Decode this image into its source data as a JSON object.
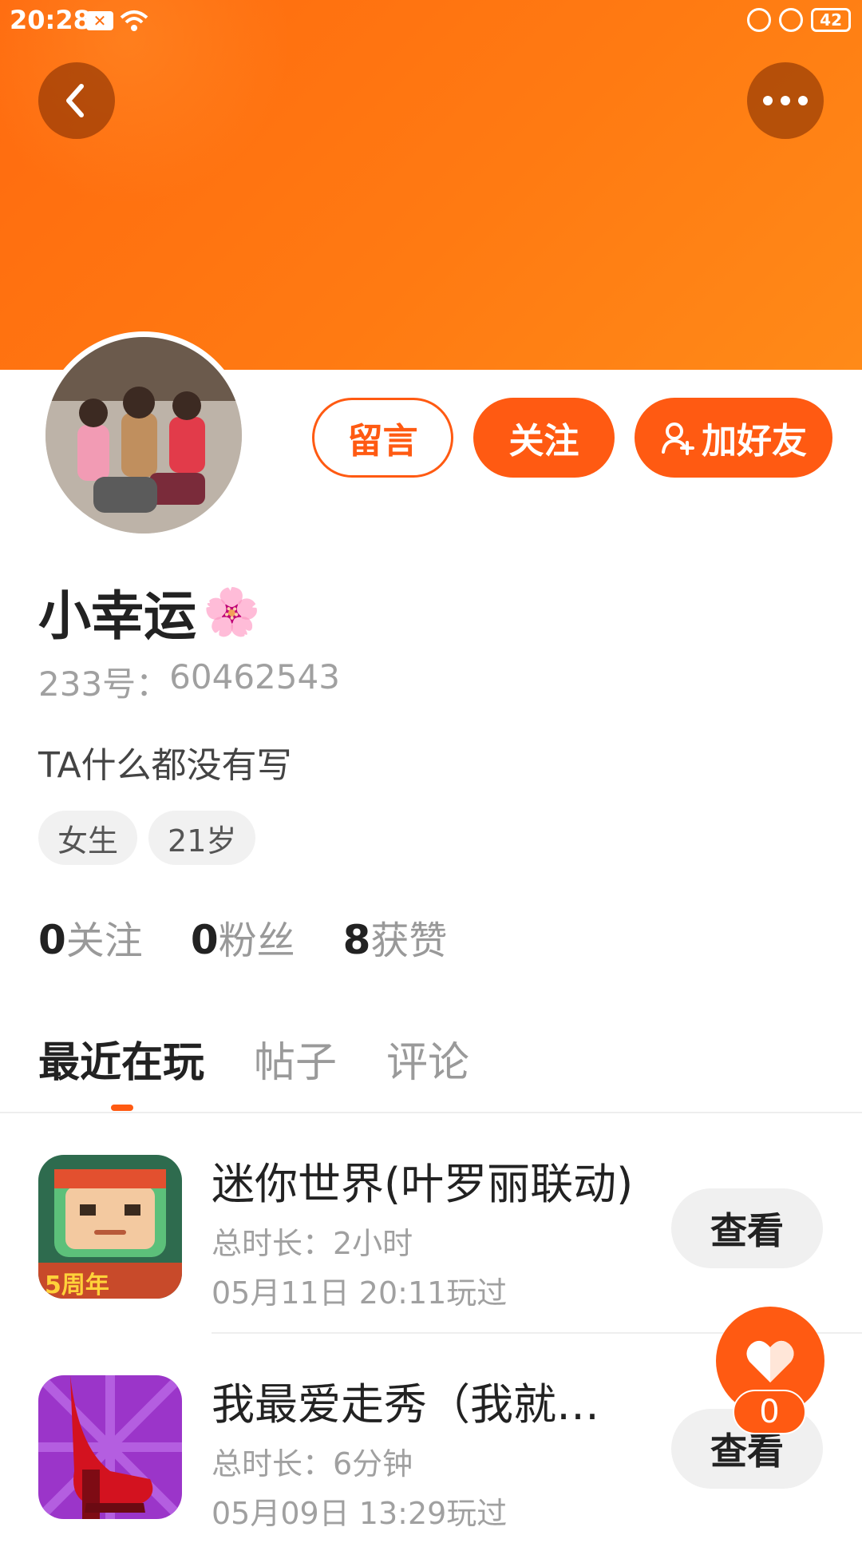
{
  "status_bar": {
    "time": "20:28",
    "battery": "42"
  },
  "profile": {
    "name": "小幸运",
    "name_emoji": "🌸",
    "uid_label": "233号：",
    "uid_value": "60462543",
    "bio": "TA什么都没有写",
    "tags": [
      "女生",
      "21岁"
    ],
    "stats": [
      {
        "value": "0",
        "label": "关注"
      },
      {
        "value": "0",
        "label": "粉丝"
      },
      {
        "value": "8",
        "label": "获赞"
      }
    ]
  },
  "actions": {
    "message": "留言",
    "follow": "关注",
    "add_friend": "加好友"
  },
  "tabs": [
    {
      "label": "最近在玩",
      "active": true
    },
    {
      "label": "帖子",
      "active": false
    },
    {
      "label": "评论",
      "active": false
    }
  ],
  "games": [
    {
      "title": "迷你世界(叶罗丽联动)",
      "duration": "总时长：2小时",
      "last_played": "05月11日 20:11玩过",
      "button": "查看",
      "icon": "mini-world-game-icon",
      "badge": "5周年"
    },
    {
      "title": "我最爱走秀（我就是…",
      "duration": "总时长：6分钟",
      "last_played": "05月09日 13:29玩过",
      "button": "查看",
      "icon": "high-heel-game-icon"
    }
  ],
  "like": {
    "count": "0"
  },
  "colors": {
    "accent": "#ff5a12",
    "header": "#ff7a12"
  },
  "icons": [
    "back-arrow-icon",
    "more-dots-icon",
    "add-person-icon",
    "heart-icon"
  ]
}
